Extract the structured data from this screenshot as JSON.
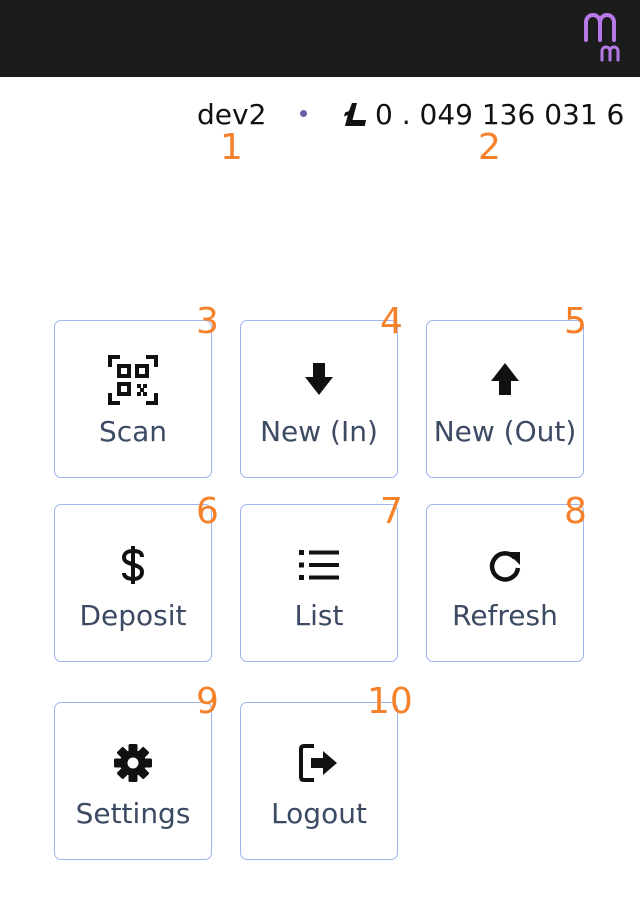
{
  "header": {
    "logo_icon": "purple-m-logo",
    "user_name": "dev2",
    "separator": "•",
    "currency_icon": "litecoin-icon",
    "balance": "0 . 049 136 031 6"
  },
  "annotations": {
    "user": "1",
    "balance": "2",
    "scan": "3",
    "new_in": "4",
    "new_out": "5",
    "deposit": "6",
    "list": "7",
    "refresh": "8",
    "settings": "9",
    "logout": "10"
  },
  "tiles": {
    "scan": {
      "label": "Scan",
      "icon": "qr-scan-icon"
    },
    "new_in": {
      "label": "New (In)",
      "icon": "arrow-down-icon"
    },
    "new_out": {
      "label": "New (Out)",
      "icon": "arrow-up-icon"
    },
    "deposit": {
      "label": "Deposit",
      "icon": "dollar-icon"
    },
    "list": {
      "label": "List",
      "icon": "list-icon"
    },
    "refresh": {
      "label": "Refresh",
      "icon": "refresh-icon"
    },
    "settings": {
      "label": "Settings",
      "icon": "gear-icon"
    },
    "logout": {
      "label": "Logout",
      "icon": "logout-icon"
    }
  },
  "colors": {
    "topbar": "#1c1c1c",
    "logo": "#b57ae8",
    "tile_border": "#9fb6ec",
    "tile_label": "#3c4b63",
    "badge": "#f5822a"
  }
}
